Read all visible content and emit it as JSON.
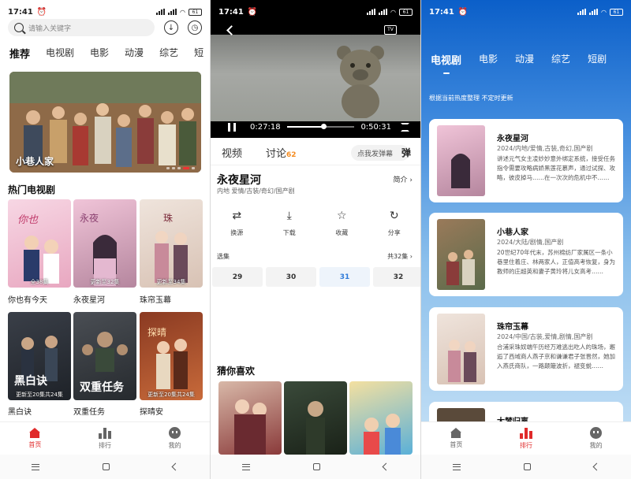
{
  "status": {
    "time": "17:41",
    "battery": "61"
  },
  "home": {
    "search_placeholder": "请输入关键字",
    "categories": [
      "推荐",
      "电视剧",
      "电影",
      "动漫",
      "综艺",
      "短"
    ],
    "banner_title": "小巷人家",
    "section_title": "热门电视剧",
    "posters": [
      {
        "name": "你也有今天",
        "caption": "全38集"
      },
      {
        "name": "永夜星河",
        "caption": "更新至32集"
      },
      {
        "name": "珠帘玉幕",
        "caption": "更新至34集"
      },
      {
        "name": "黑白诀",
        "caption": "更新至20集共24集"
      },
      {
        "name": "双重任务",
        "caption": ""
      },
      {
        "name": "探晴安",
        "caption": "更新至20集共24集"
      }
    ]
  },
  "tabbar": {
    "home": "首页",
    "rank": "排行",
    "me": "我的"
  },
  "player": {
    "current": "0:27:18",
    "total": "0:50:31",
    "progress": 0.54,
    "tv_label": "TV",
    "tab_video": "视频",
    "tab_discuss": "讨论",
    "discuss_count": "62",
    "danmu_placeholder": "点我发弹幕",
    "danmu_button": "弹",
    "title": "永夜星河",
    "tags": "内地 爱情/古装/奇幻/国产剧",
    "intro": "简介",
    "actions": [
      "换源",
      "下载",
      "收藏",
      "分享"
    ],
    "episodes_label": "选集",
    "episodes_total": "共32集",
    "episodes": [
      "29",
      "30",
      "31",
      "32"
    ],
    "guess_title": "猜你喜欢"
  },
  "ranking": {
    "tabs": [
      "电视剧",
      "电影",
      "动漫",
      "综艺",
      "短剧"
    ],
    "note": "根据当前热度整理 不定时更新",
    "items": [
      {
        "title": "永夜星河",
        "meta": "2024/内地/爱情,古装,奇幻,国产剧",
        "desc": "讲述元气女主凌妙妙意外绑定系统，接受任务指令需要攻略病娇黑莲花慕声，通过试探、攻略，彼皮掉马……在一次次的危机中不……"
      },
      {
        "title": "小巷人家",
        "meta": "2024/大陆/剧情,国产剧",
        "desc": "20世纪70年代末，苏州棉纺厂家属区一条小巷里住着庄、林两家人，正值高考恢复，身为教师的庄超英和妻子黄玲将儿女高考……"
      },
      {
        "title": "珠帘玉幕",
        "meta": "2024/中国/古装,爱情,剧情,国产剧",
        "desc": "合浦采珠奴端午历经万难逃出吃人的珠场，邂逅了西域商人燕子京和谦谦君子张晋然，她加入燕氏商队，一路颠簸波折，褪变蜕……"
      },
      {
        "title": "大梦归离",
        "meta": "",
        "desc": ""
      }
    ]
  }
}
